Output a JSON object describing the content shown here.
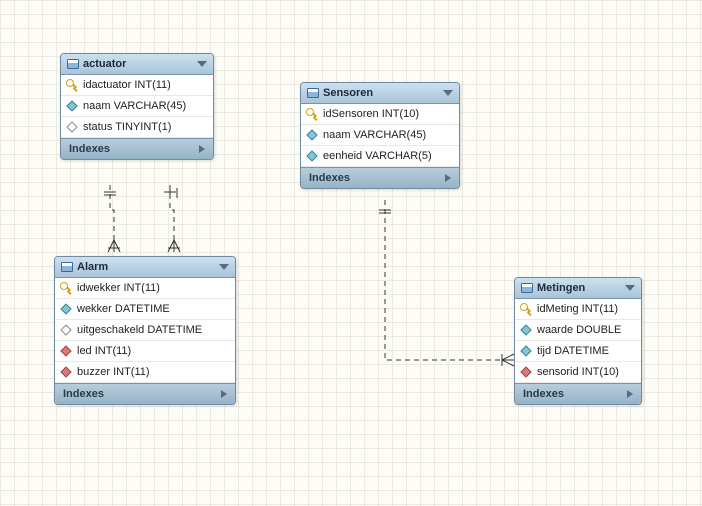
{
  "entities": {
    "actuator": {
      "title": "actuator",
      "indexes_label": "Indexes",
      "columns": [
        {
          "name": "idactuator INT(11)",
          "icon": "key"
        },
        {
          "name": "naam VARCHAR(45)",
          "icon": "cyan"
        },
        {
          "name": "status TINYINT(1)",
          "icon": "white"
        }
      ]
    },
    "sensoren": {
      "title": "Sensoren",
      "indexes_label": "Indexes",
      "columns": [
        {
          "name": "idSensoren INT(10)",
          "icon": "key"
        },
        {
          "name": "naam VARCHAR(45)",
          "icon": "cyan"
        },
        {
          "name": "eenheid VARCHAR(5)",
          "icon": "cyan"
        }
      ]
    },
    "alarm": {
      "title": "Alarm",
      "indexes_label": "Indexes",
      "columns": [
        {
          "name": "idwekker INT(11)",
          "icon": "key"
        },
        {
          "name": "wekker DATETIME",
          "icon": "cyan"
        },
        {
          "name": "uitgeschakeld DATETIME",
          "icon": "white"
        },
        {
          "name": "led INT(11)",
          "icon": "red"
        },
        {
          "name": "buzzer INT(11)",
          "icon": "red"
        }
      ]
    },
    "metingen": {
      "title": "Metingen",
      "indexes_label": "Indexes",
      "columns": [
        {
          "name": "idMeting INT(11)",
          "icon": "key"
        },
        {
          "name": "waarde DOUBLE",
          "icon": "cyan"
        },
        {
          "name": "tijd DATETIME",
          "icon": "cyan"
        },
        {
          "name": "sensorid INT(10)",
          "icon": "red"
        }
      ]
    }
  },
  "relationships": [
    {
      "from": "actuator",
      "to": "alarm",
      "type": "one-to-many",
      "style": "dashed"
    },
    {
      "from": "actuator",
      "to": "alarm",
      "type": "one-to-many",
      "style": "dashed"
    },
    {
      "from": "sensoren",
      "to": "metingen",
      "type": "one-to-many",
      "style": "dashed"
    }
  ]
}
